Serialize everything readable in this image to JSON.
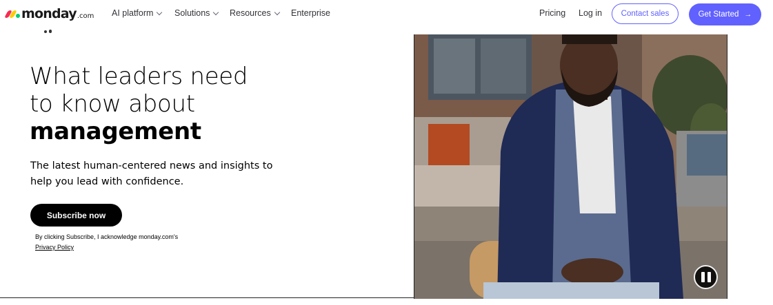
{
  "nav": {
    "logo_word": "monday",
    "logo_suffix": ".com",
    "items": [
      {
        "label": "AI platform",
        "has_dropdown": true
      },
      {
        "label": "Solutions",
        "has_dropdown": true
      },
      {
        "label": "Resources",
        "has_dropdown": true
      },
      {
        "label": "Enterprise",
        "has_dropdown": false
      }
    ],
    "pricing": "Pricing",
    "login": "Log in",
    "contact_sales": "Contact sales",
    "get_started": "Get Started",
    "get_started_icon": "arrow-right-icon"
  },
  "hero": {
    "title_line1": "What leaders need",
    "title_line2": "to know about",
    "title_bold": "management",
    "subtitle": "The latest human-centered news and insights to help you lead with confidence.",
    "subscribe_label": "Subscribe now",
    "disclaimer": "By clicking Subscribe, I acknowledge monday.com's",
    "privacy_link": "Privacy Policy"
  },
  "video": {
    "control_icon": "pause-icon"
  },
  "colors": {
    "accent": "#6161ff",
    "logo_red": "#f62b54",
    "logo_yellow": "#ffcc00",
    "logo_green": "#00ca72"
  }
}
